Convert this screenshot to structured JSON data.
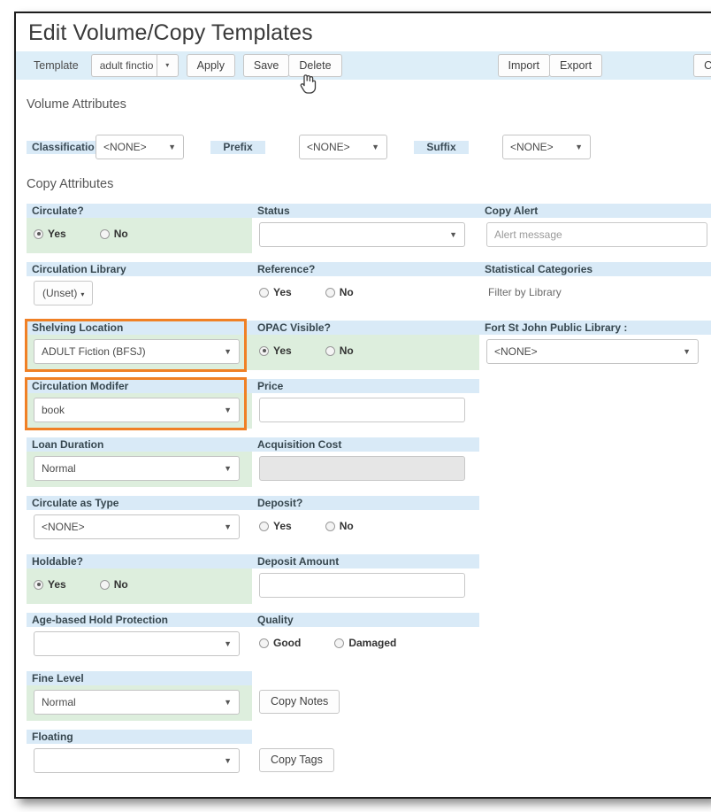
{
  "window": {
    "title": "Edit Volume/Copy Templates"
  },
  "toolbar": {
    "template_label": "Template",
    "template_value": "adult finctio",
    "apply_label": "Apply",
    "save_label": "Save",
    "delete_label": "Delete",
    "import_label": "Import",
    "export_label": "Export",
    "clear_label": "Clear",
    "caret_icon": "▾"
  },
  "cursor": {
    "icon": "pointing-hand-cursor"
  },
  "volume_attributes": {
    "section_title": "Volume Attributes",
    "classification_label": "Classificatio",
    "classification_value": "<NONE>",
    "prefix_label": "Prefix",
    "prefix_value": "<NONE>",
    "suffix_label": "Suffix",
    "suffix_value": "<NONE>"
  },
  "copy_attributes": {
    "section_title": "Copy Attributes",
    "rows": [
      {
        "col1": {
          "label": "Circulate?",
          "type": "radio",
          "green": true,
          "options": [
            {
              "text": "Yes",
              "selected": true
            },
            {
              "text": "No",
              "selected": false
            }
          ]
        },
        "col2": {
          "label": "Status",
          "type": "select",
          "value": ""
        },
        "col3": {
          "label": "Copy Alert",
          "type": "text",
          "placeholder": "Alert message"
        }
      },
      {
        "col1": {
          "label": "Circulation Library",
          "type": "button",
          "value": "(Unset)"
        },
        "col2": {
          "label": "Reference?",
          "type": "radio",
          "green": false,
          "options": [
            {
              "text": "Yes",
              "selected": false
            },
            {
              "text": "No",
              "selected": false
            }
          ]
        },
        "col3": {
          "label": "Statistical Categories",
          "type": "plain",
          "value": "Filter by Library"
        }
      },
      {
        "col1": {
          "label": "Shelving Location",
          "type": "select",
          "value": "ADULT Fiction (BFSJ)",
          "green": true,
          "highlight": true
        },
        "col2": {
          "label": "OPAC Visible?",
          "type": "radio",
          "green": true,
          "options": [
            {
              "text": "Yes",
              "selected": true
            },
            {
              "text": "No",
              "selected": false
            }
          ]
        },
        "col3": {
          "label": "Fort St John Public Library :",
          "type": "select",
          "value": "<NONE>"
        }
      },
      {
        "col1": {
          "label": "Circulation Modifer",
          "type": "select",
          "value": "book",
          "green": true,
          "highlight": true
        },
        "col2": {
          "label": "Price",
          "type": "text",
          "value": ""
        },
        "col3": null
      },
      {
        "col1": {
          "label": "Loan Duration",
          "type": "select",
          "value": "Normal",
          "green": true
        },
        "col2": {
          "label": "Acquisition Cost",
          "type": "text",
          "value": "",
          "disabled": true
        },
        "col3": null
      },
      {
        "col1": {
          "label": "Circulate as Type",
          "type": "select",
          "value": "<NONE>"
        },
        "col2": {
          "label": "Deposit?",
          "type": "radio",
          "green": false,
          "options": [
            {
              "text": "Yes",
              "selected": false
            },
            {
              "text": "No",
              "selected": false
            }
          ]
        },
        "col3": null
      },
      {
        "col1": {
          "label": "Holdable?",
          "type": "radio",
          "green": true,
          "options": [
            {
              "text": "Yes",
              "selected": true
            },
            {
              "text": "No",
              "selected": false
            }
          ]
        },
        "col2": {
          "label": "Deposit Amount",
          "type": "text",
          "value": ""
        },
        "col3": null
      },
      {
        "col1": {
          "label": "Age-based Hold Protection",
          "type": "select",
          "value": ""
        },
        "col2": {
          "label": "Quality",
          "type": "radio",
          "green": false,
          "options": [
            {
              "text": "Good",
              "selected": false
            },
            {
              "text": "Damaged",
              "selected": false
            }
          ]
        },
        "col3": null
      },
      {
        "col1": {
          "label": "Fine Level",
          "type": "select",
          "value": "Normal",
          "green": true
        },
        "col2": {
          "label": "",
          "type": "button2",
          "value": "Copy Notes"
        },
        "col3": null
      },
      {
        "col1": {
          "label": "Floating",
          "type": "select",
          "value": ""
        },
        "col2": {
          "label": "",
          "type": "button2",
          "value": "Copy Tags"
        },
        "col3": null
      }
    ]
  },
  "colors": {
    "label_bar": "#d9eaf7",
    "toolbar_bg": "#ddeef8",
    "field_green": "#ddeedd",
    "highlight_orange": "#f08025"
  },
  "icons": {
    "select_caret": "▼",
    "small_caret": "▾"
  }
}
